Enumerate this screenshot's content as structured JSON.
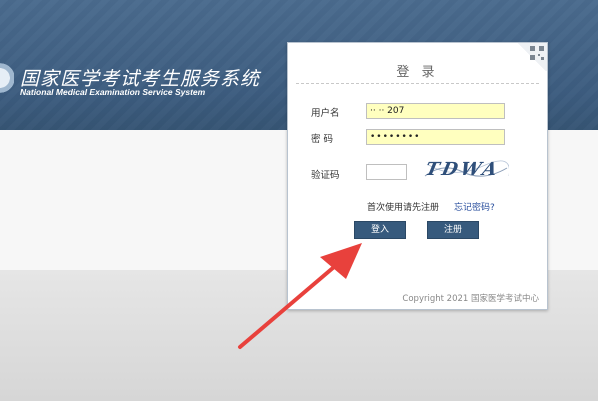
{
  "header": {
    "title": "国家医学考试考生服务系统",
    "subtitle": "National Medical Examination Service System"
  },
  "login": {
    "title": "登 录",
    "username_label": "用户名",
    "username_value": "·· ·· 207",
    "password_label": "密 码",
    "password_value": "••••••••",
    "captcha_label": "验证码",
    "captcha_value": "",
    "captcha_text": "TDWA",
    "first_use_text": "首次使用请先注册",
    "forgot_link": "忘记密码?",
    "login_button": "登入",
    "register_button": "注册",
    "copyright": "Copyright 2021 国家医学考试中心"
  },
  "colors": {
    "banner": "#3d5d80",
    "button": "#375a7d",
    "input_autofill": "#ffffbf",
    "annotation_arrow": "#e8413c"
  },
  "icons": {
    "qr_corner": "qr-code-icon",
    "annotation": "red-arrow-icon"
  }
}
